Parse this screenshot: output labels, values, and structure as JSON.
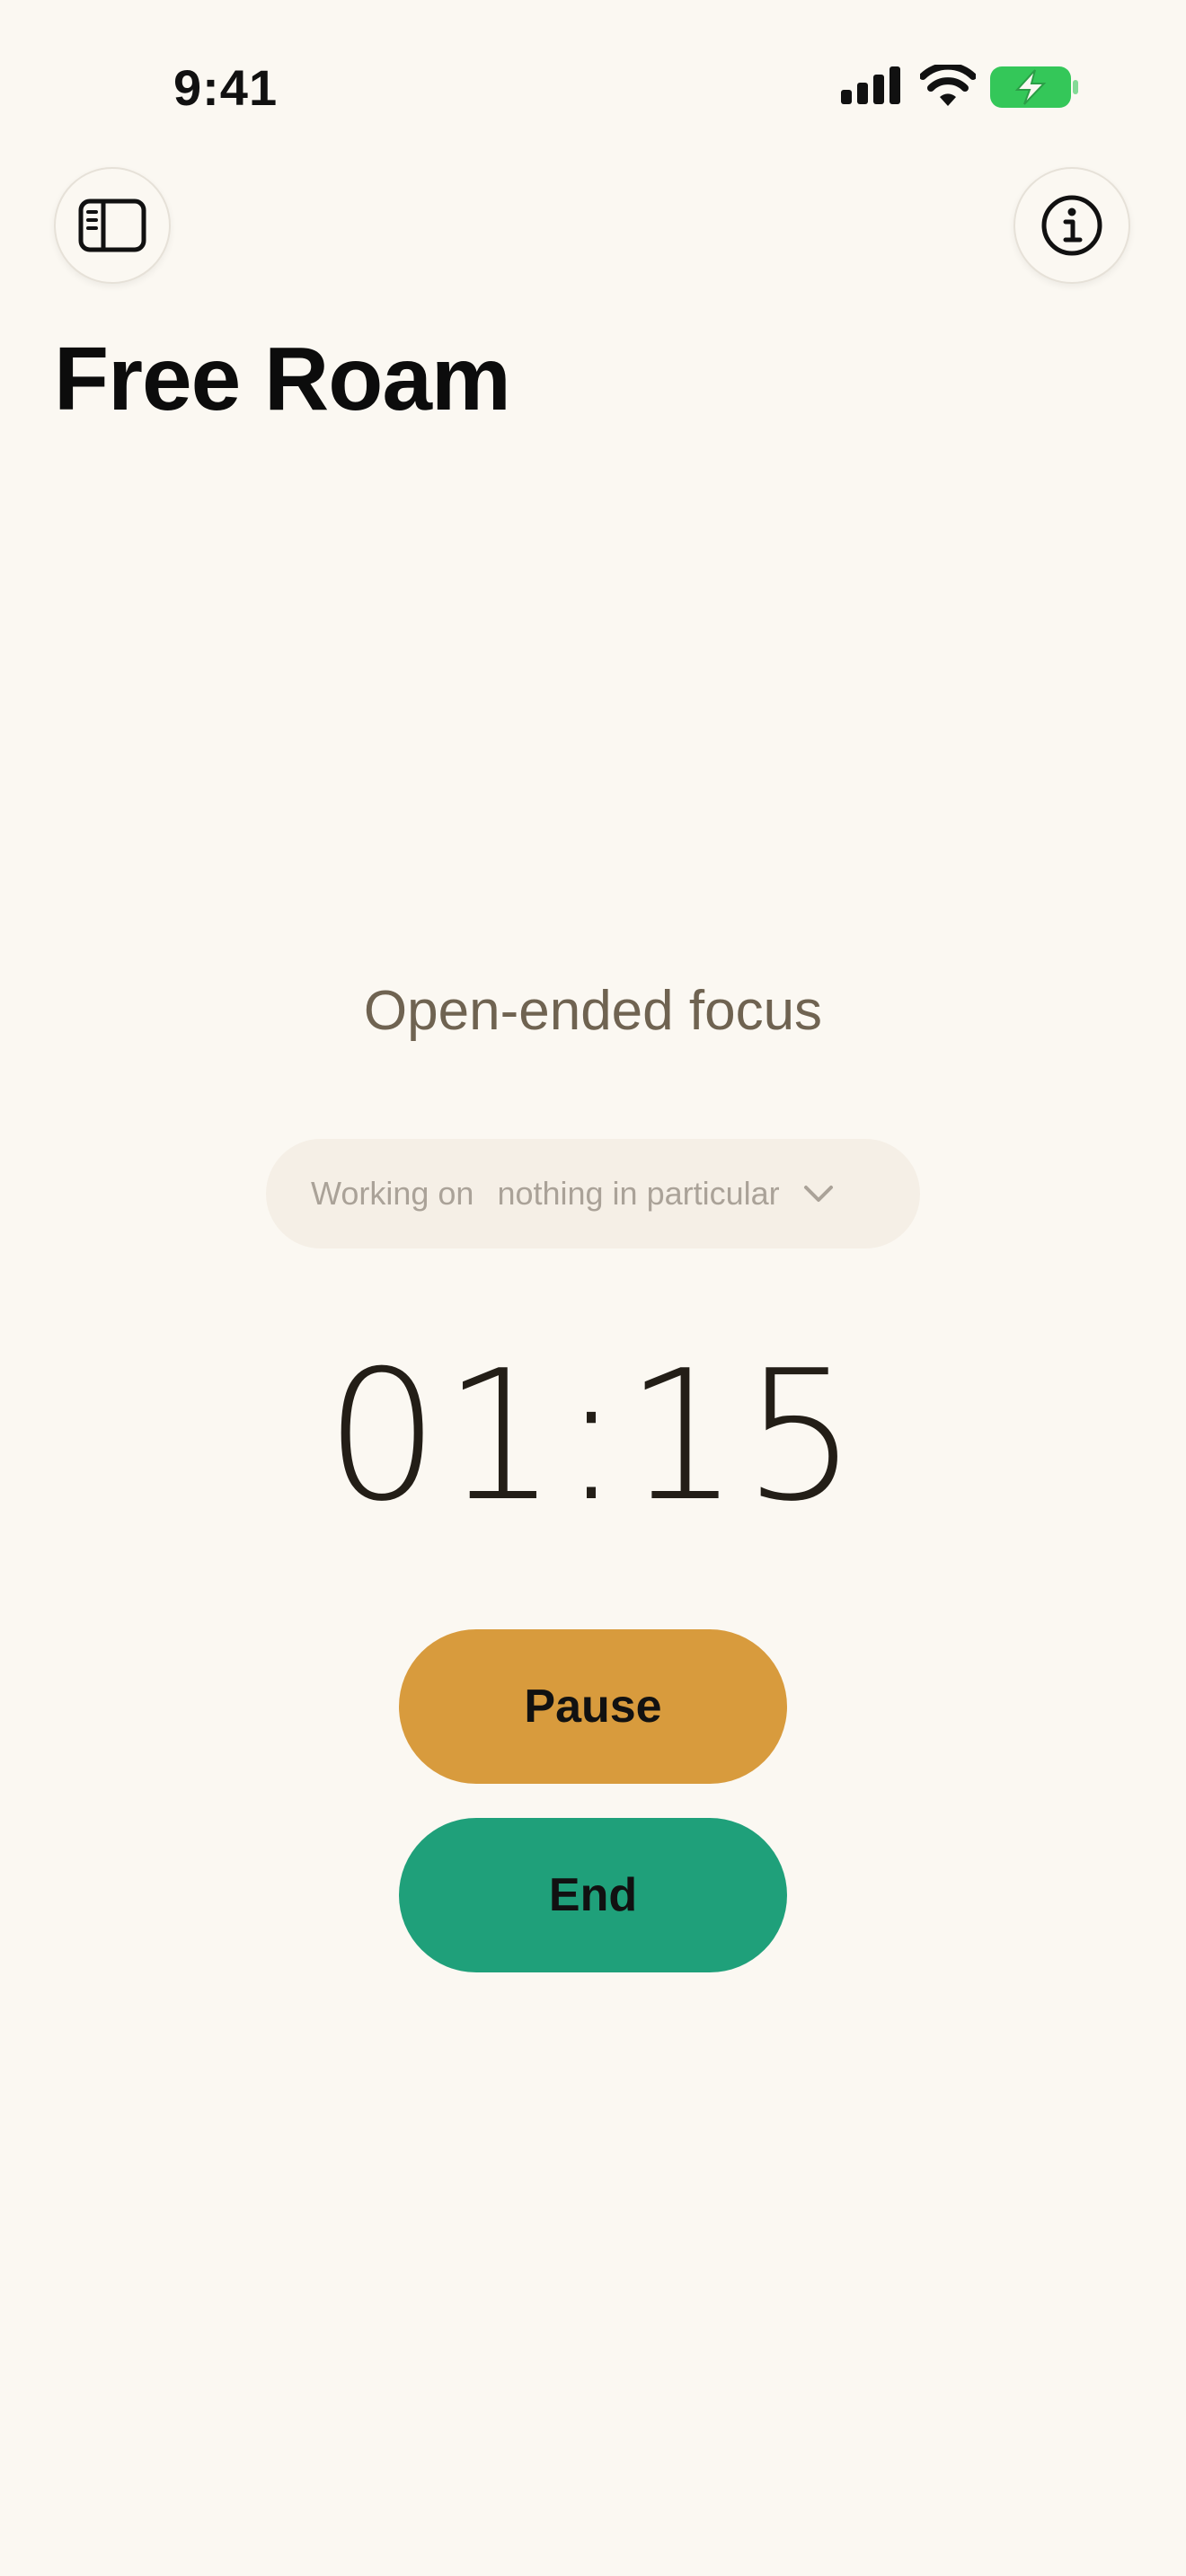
{
  "status_bar": {
    "time": "9:41"
  },
  "header": {
    "title": "Free Roam"
  },
  "focus": {
    "subtitle": "Open-ended focus",
    "selector_prefix": "Working on",
    "selector_value": "nothing in particular",
    "timer": "01:15"
  },
  "actions": {
    "pause_label": "Pause",
    "end_label": "End"
  },
  "colors": {
    "background": "#FBF8F2",
    "pause": "#D89B3D",
    "end": "#1FA07A",
    "battery": "#34C759"
  },
  "icons": {
    "left_button": "sidebar-icon",
    "right_button": "info-icon"
  }
}
